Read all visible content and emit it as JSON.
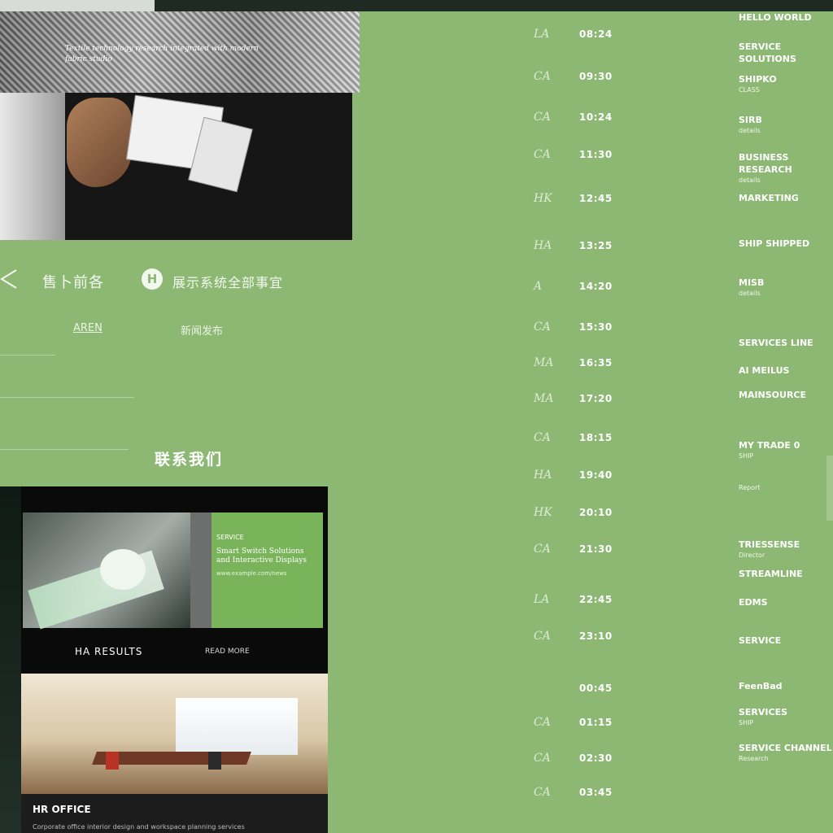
{
  "fabric_panel": {
    "caption": "Textile technology research integrated with modern fabric studio"
  },
  "left_nav": {
    "title": "售卜前各",
    "badge_letter": "H",
    "subtitle": "展示系统全部事宜",
    "link_primary": "AREN",
    "link_secondary": "新闻发布"
  },
  "section_heading": "联系我们",
  "promo": {
    "kicker": "SERVICE",
    "title": "Smart Switch Solutions and Interactive Displays",
    "meta": "www.example.com/news",
    "caption": "HA RESULTS",
    "caption_small": "READ MORE"
  },
  "office_footer": {
    "title": "HR OFFICE",
    "meta": "Corporate office interior design and workspace planning services"
  },
  "schedule": [
    {
      "code": "LA",
      "time": "08:24"
    },
    {
      "code": "CA",
      "time": "09:30"
    },
    {
      "code": "CA",
      "time": "10:24"
    },
    {
      "code": "CA",
      "time": "11:30"
    },
    {
      "code": "HK",
      "time": "12:45"
    },
    {
      "code": "HA",
      "time": "13:25"
    },
    {
      "code": "A",
      "time": "14:20"
    },
    {
      "code": "CA",
      "time": "15:30"
    },
    {
      "code": "MA",
      "time": "16:35"
    },
    {
      "code": "MA",
      "time": "17:20"
    },
    {
      "code": "CA",
      "time": "18:15"
    },
    {
      "code": "HA",
      "time": "19:40"
    },
    {
      "code": "HK",
      "time": "20:10"
    },
    {
      "code": "CA",
      "time": "21:30"
    },
    {
      "code": "LA",
      "time": "22:45"
    },
    {
      "code": "CA",
      "time": "23:10"
    },
    {
      "code": "",
      "time": "00:45"
    },
    {
      "code": "CA",
      "time": "01:15"
    },
    {
      "code": "CA",
      "time": "02:30"
    },
    {
      "code": "CA",
      "time": "03:45"
    }
  ],
  "info_blocks": [
    {
      "primary": "HELLO WORLD",
      "secondary": ""
    },
    {
      "primary": "SERVICE SOLUTIONS",
      "secondary": ""
    },
    {
      "primary": "SHIPKO",
      "secondary": "CLASS"
    },
    {
      "primary": "SIRB",
      "secondary": "details"
    },
    {
      "primary": "BUSINESS RESEARCH",
      "secondary": "details"
    },
    {
      "primary": "MARKETING",
      "secondary": ""
    },
    {
      "primary": "SHIP SHIPPED",
      "secondary": ""
    },
    {
      "primary": "MISB",
      "secondary": "details"
    },
    {
      "primary": "SERVICES LINE",
      "secondary": ""
    },
    {
      "primary": "AI MEILUS",
      "secondary": ""
    },
    {
      "primary": "MAINSOURCE",
      "secondary": ""
    },
    {
      "primary": "MY TRADE 0",
      "secondary": "SHIP"
    },
    {
      "primary": "",
      "secondary": "Report"
    },
    {
      "primary": "TRIESSENSE",
      "secondary": "Director"
    },
    {
      "primary": "STREAMLINE",
      "secondary": ""
    },
    {
      "primary": "EDMS",
      "secondary": ""
    },
    {
      "primary": "SERVICE",
      "secondary": ""
    },
    {
      "primary": "FeenBad",
      "secondary": ""
    },
    {
      "primary": "SERVICES",
      "secondary": "SHIP"
    },
    {
      "primary": "SERVICE CHANNEL",
      "secondary": "Research"
    }
  ]
}
